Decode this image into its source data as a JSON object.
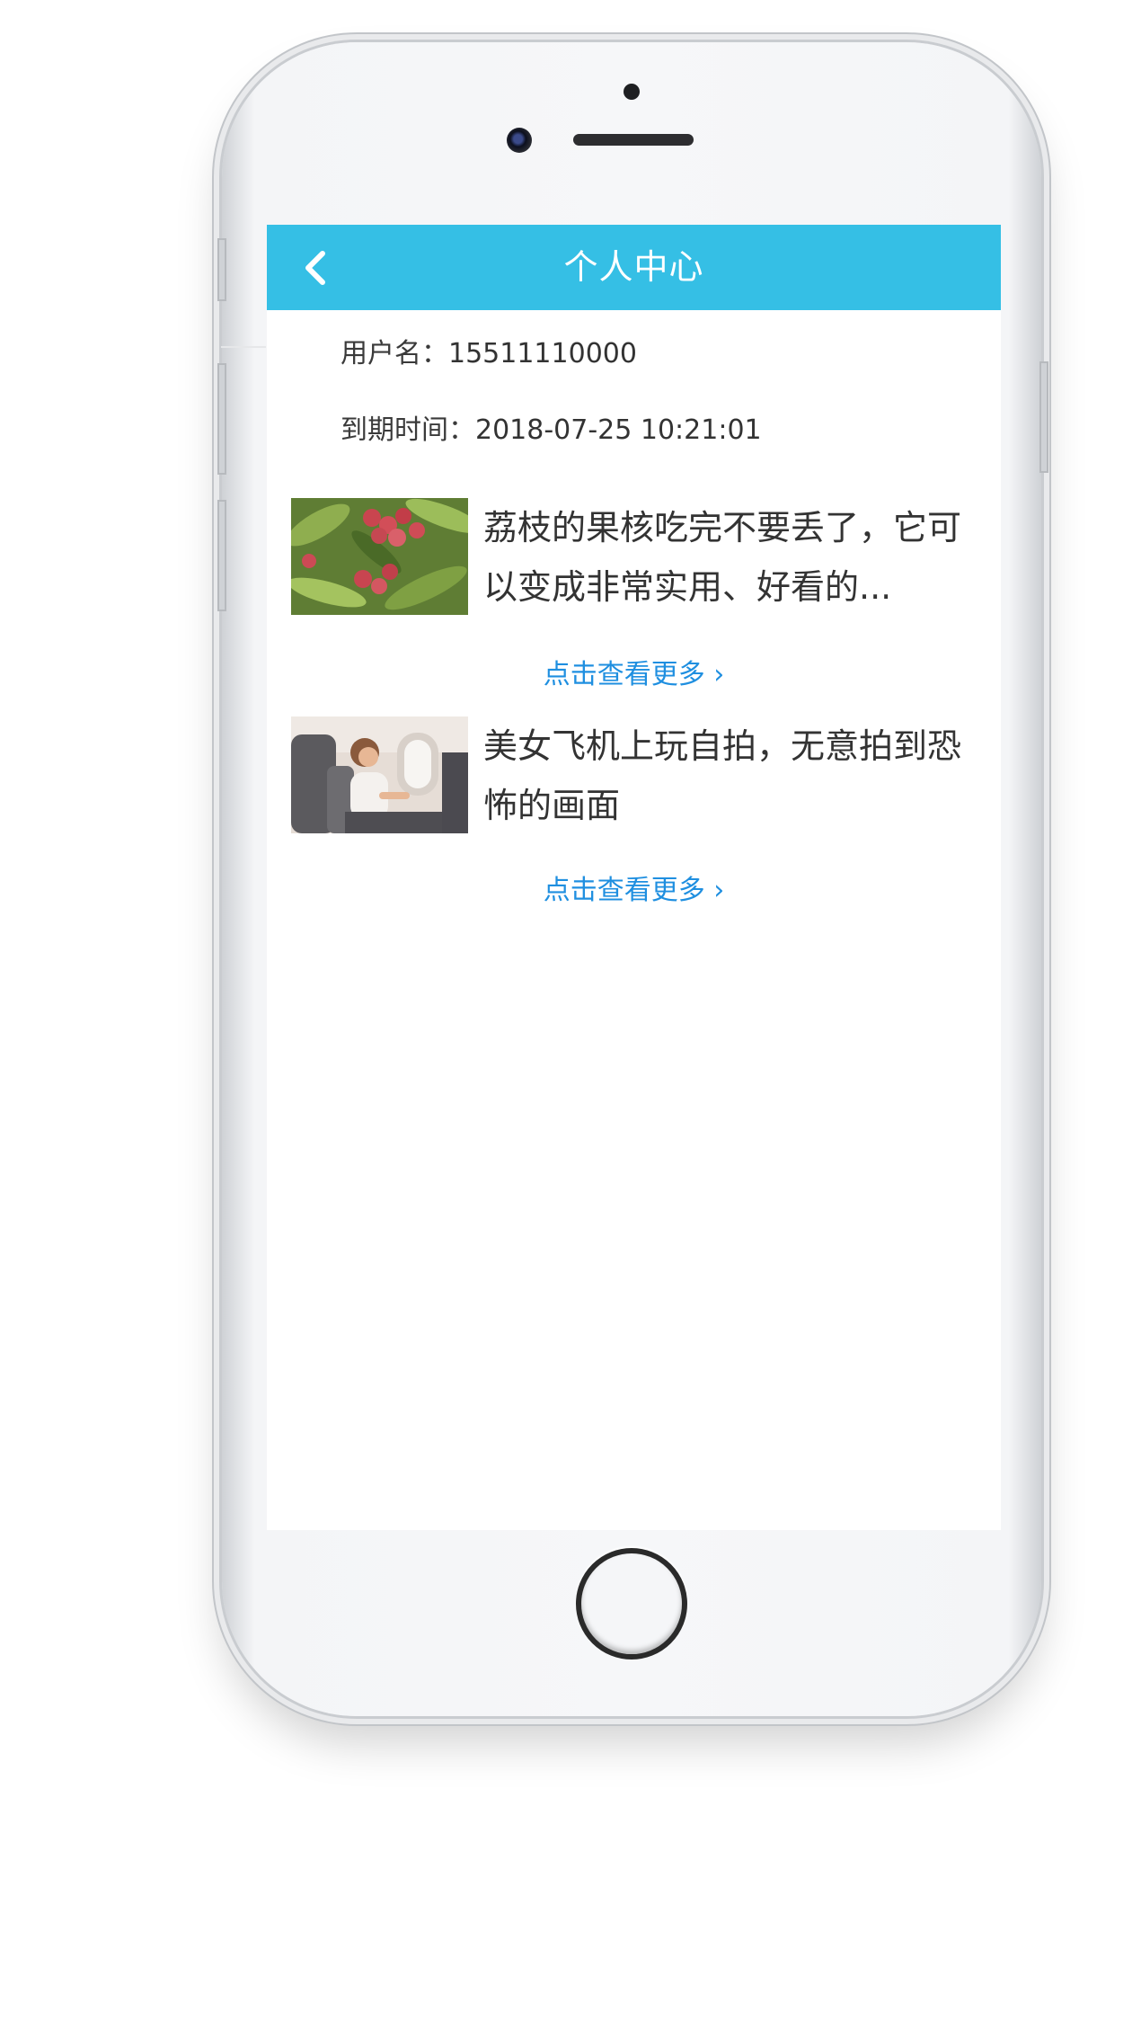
{
  "header": {
    "back_icon": "chevron-left-icon",
    "title": "个人中心"
  },
  "profile": {
    "username_label": "用户名：",
    "username_value": "15511110000",
    "expire_label": "到期时间：",
    "expire_value": "2018-07-25 10:21:01"
  },
  "articles": [
    {
      "title": "荔枝的果核吃完不要丢了，它可以变成非常实用、好看的...",
      "thumb": "lychee-photo",
      "more_label": "点击查看更多 ›"
    },
    {
      "title": "美女飞机上玩自拍，无意拍到恐怖的画面",
      "thumb": "airplane-woman-photo",
      "more_label": "点击查看更多 ›"
    }
  ],
  "colors": {
    "accent": "#35bfe5",
    "link": "#1f8fe0"
  }
}
